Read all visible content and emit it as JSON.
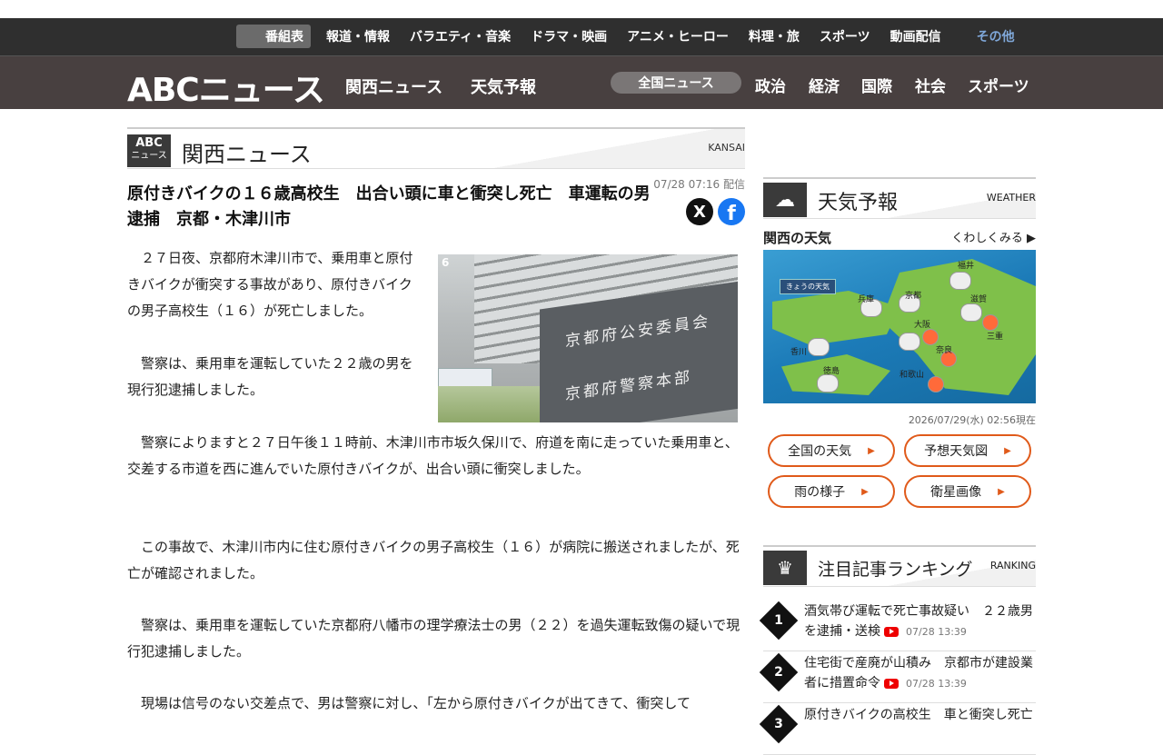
{
  "topnav": {
    "program_guide": "番組表",
    "items": [
      "報道・情報",
      "バラエティ・音楽",
      "ドラマ・映画",
      "アニメ・ヒーロー",
      "料理・旅",
      "スポーツ",
      "動画配信"
    ],
    "more": "その他"
  },
  "header": {
    "logo": "ABCニュース",
    "links": [
      "関西ニュース",
      "天気予報"
    ],
    "national_news": "全国ニュース",
    "categories": [
      "政治",
      "経済",
      "国際",
      "社会",
      "スポーツ"
    ]
  },
  "section": {
    "badge_top": "ABC",
    "badge_bottom": "ニュース",
    "title": "関西ニュース",
    "title_en": "KANSAI"
  },
  "article": {
    "dateline": "07/28 07:16 配信",
    "headline": "原付きバイクの１６歳高校生　出合い頭に車と衝突し死亡　車運転の男逮捕　京都・木津川市",
    "share_x": "X",
    "share_fb": "f",
    "photo_channel": "6",
    "photo_sign_1": "京都府公安委員会",
    "photo_sign_2": "京都府警察本部",
    "paragraphs": [
      "　２７日夜、京都府木津川市で、乗用車と原付きバイクが衝突する事故があり、原付きバイクの男子高校生（１６）が死亡しました。",
      "　警察は、乗用車を運転していた２２歳の男を現行犯逮捕しました。",
      "　警察によりますと２７日午後１１時前、木津川市市坂久保川で、府道を南に走っていた乗用車と、交差する市道を西に進んでいた原付きバイクが、出合い頭に衝突しました。",
      "　この事故で、木津川市内に住む原付きバイクの男子高校生（１６）が病院に搬送されましたが、死亡が確認されました。",
      "　警察は、乗用車を運転していた京都府八幡市の理学療法士の男（２２）を過失運転致傷の疑いで現行犯逮捕しました。",
      "　現場は信号のない交差点で、男は警察に対し、「左から原付きバイクが出てきて、衝突して"
    ]
  },
  "weather": {
    "title": "天気予報",
    "title_en": "WEATHER",
    "region": "関西の天気",
    "details_link": "くわしくみる",
    "map_badge": "きょうの天気",
    "cities": [
      "福井",
      "兵庫",
      "京都",
      "滋賀",
      "大阪",
      "奈良",
      "香川",
      "徳島",
      "和歌山",
      "三重"
    ],
    "timestamp": "2026/07/29(水) 02:56現在",
    "buttons": [
      "全国の天気",
      "予想天気図",
      "雨の様子",
      "衛星画像"
    ]
  },
  "ranking": {
    "title": "注目記事ランキング",
    "title_en": "RANKING",
    "items": [
      {
        "rank": "1",
        "text": "酒気帯び運転で死亡事故疑い　２２歳男を逮捕・送検",
        "time": "07/28 13:39"
      },
      {
        "rank": "2",
        "text": "住宅街で産廃が山積み　京都市が建設業者に措置命令",
        "time": "07/28 13:39"
      },
      {
        "rank": "3",
        "text": "原付きバイクの高校生　車と衝突し死亡",
        "time": ""
      }
    ]
  },
  "colors": {
    "accent": "#e05a1a",
    "header_dark": "#2f2f2f",
    "header_main": "#484040"
  }
}
